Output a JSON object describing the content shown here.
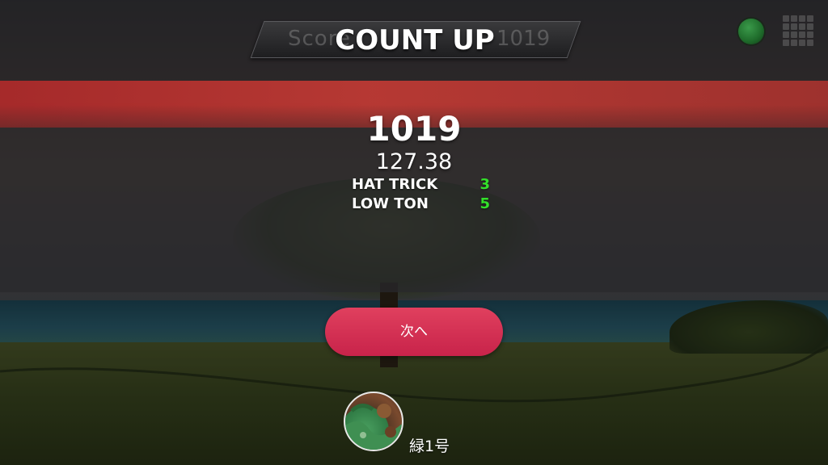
{
  "header": {
    "title": "COUNT UP",
    "ghost_label": "Score",
    "ghost_score": "1019"
  },
  "icons": {
    "status": "status-indicator-icon",
    "menu": "grid-menu-icon",
    "status_color": "#2a8a3a"
  },
  "result": {
    "total_score": "1019",
    "average": "127.38",
    "awards": [
      {
        "label": "HAT TRICK",
        "count": "3"
      },
      {
        "label": "LOW TON",
        "count": "5"
      }
    ],
    "award_count_color": "#33e02a"
  },
  "actions": {
    "next_label": "次へ",
    "next_color": "#d02f52"
  },
  "player": {
    "name": "緑1号"
  }
}
